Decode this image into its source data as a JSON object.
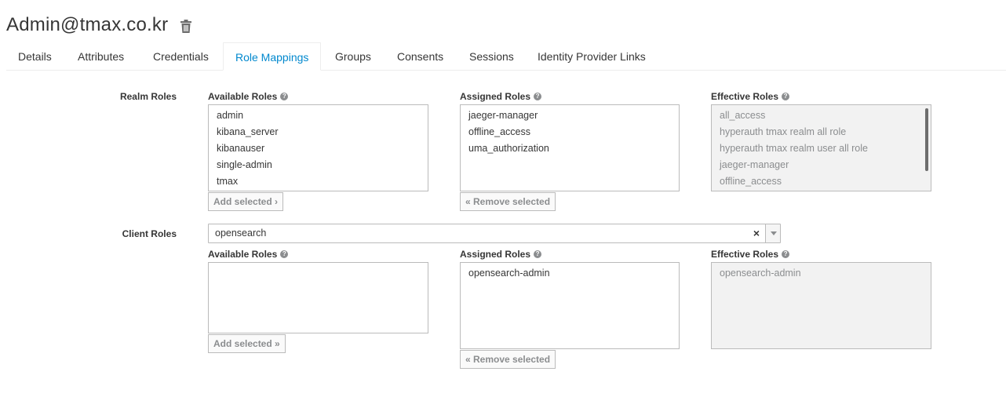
{
  "header": {
    "title": "Admin@tmax.co.kr",
    "delete_icon": "trash-icon"
  },
  "tabs": [
    {
      "label": "Details"
    },
    {
      "label": "Attributes"
    },
    {
      "label": "Credentials"
    },
    {
      "label": "Role Mappings",
      "active": true
    },
    {
      "label": "Groups"
    },
    {
      "label": "Consents"
    },
    {
      "label": "Sessions"
    },
    {
      "label": "Identity Provider Links"
    }
  ],
  "realm_roles": {
    "label": "Realm Roles",
    "available": {
      "label": "Available Roles",
      "items": [
        "admin",
        "kibana_server",
        "kibanauser",
        "single-admin",
        "tmax"
      ],
      "button": "Add selected ›"
    },
    "assigned": {
      "label": "Assigned Roles",
      "items": [
        "jaeger-manager",
        "offline_access",
        "uma_authorization"
      ],
      "button": "« Remove selected"
    },
    "effective": {
      "label": "Effective Roles",
      "items": [
        "all_access",
        "hyperauth tmax realm all role",
        "hyperauth tmax realm user all role",
        "jaeger-manager",
        "offline_access"
      ]
    }
  },
  "client_roles": {
    "label": "Client Roles",
    "client_select": {
      "value": "opensearch",
      "clear": "×"
    },
    "available": {
      "label": "Available Roles",
      "items": [],
      "button": "Add selected »"
    },
    "assigned": {
      "label": "Assigned Roles",
      "items": [
        "opensearch-admin"
      ],
      "button": "« Remove selected"
    },
    "effective": {
      "label": "Effective Roles",
      "items": [
        "opensearch-admin"
      ]
    }
  },
  "colors": {
    "accent": "#0088ce",
    "text": "#363636",
    "muted": "#8b8d8f",
    "border": "#bbbbbb"
  }
}
